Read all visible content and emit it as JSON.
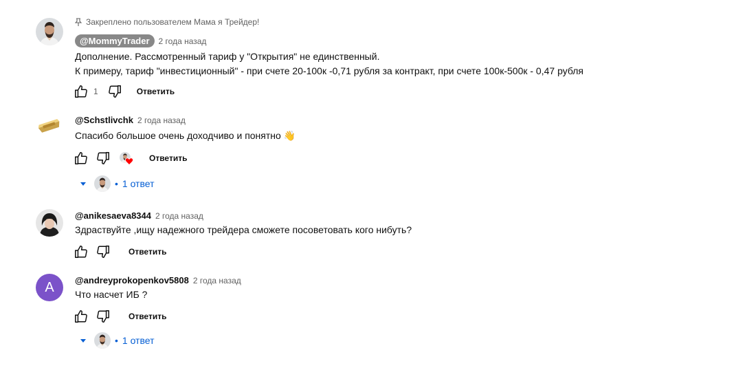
{
  "comments": [
    {
      "pinned_text": "Закреплено пользователем Мама я Трейдер!",
      "author": "@MommyTrader",
      "time": "2 года назад",
      "lines": [
        "Дополнение. Рассмотренный тариф у \"Открытия\" не единственный.",
        "К примеру, тариф \"инвестиционный\" - при счете 20-100к -0,71 рубля за контракт, при счете 100к-500к - 0,47 рубля"
      ],
      "likes": "1",
      "reply_label": "Ответить"
    },
    {
      "author": "@Schstlivchk",
      "time": "2 года назад",
      "text": "Спасибо большое очень доходчиво и понятно",
      "emoji": "👋",
      "reply_label": "Ответить",
      "replies_label": "1 ответ"
    },
    {
      "author": "@anikesaeva8344",
      "time": "2 года назад",
      "text": "Здраствуйте ,ищу надежного трейдера сможете посоветовать кого нибуть?",
      "reply_label": "Ответить"
    },
    {
      "author": "@andreyprokopenkov5808",
      "time": "2 года назад",
      "avatar_letter": "A",
      "text": "Что насчет ИБ ?",
      "reply_label": "Ответить",
      "replies_label": "1 ответ"
    }
  ],
  "colors": {
    "link": "#065fd4",
    "letter_avatar": "#7b52c9",
    "heart": "#ff0000"
  }
}
